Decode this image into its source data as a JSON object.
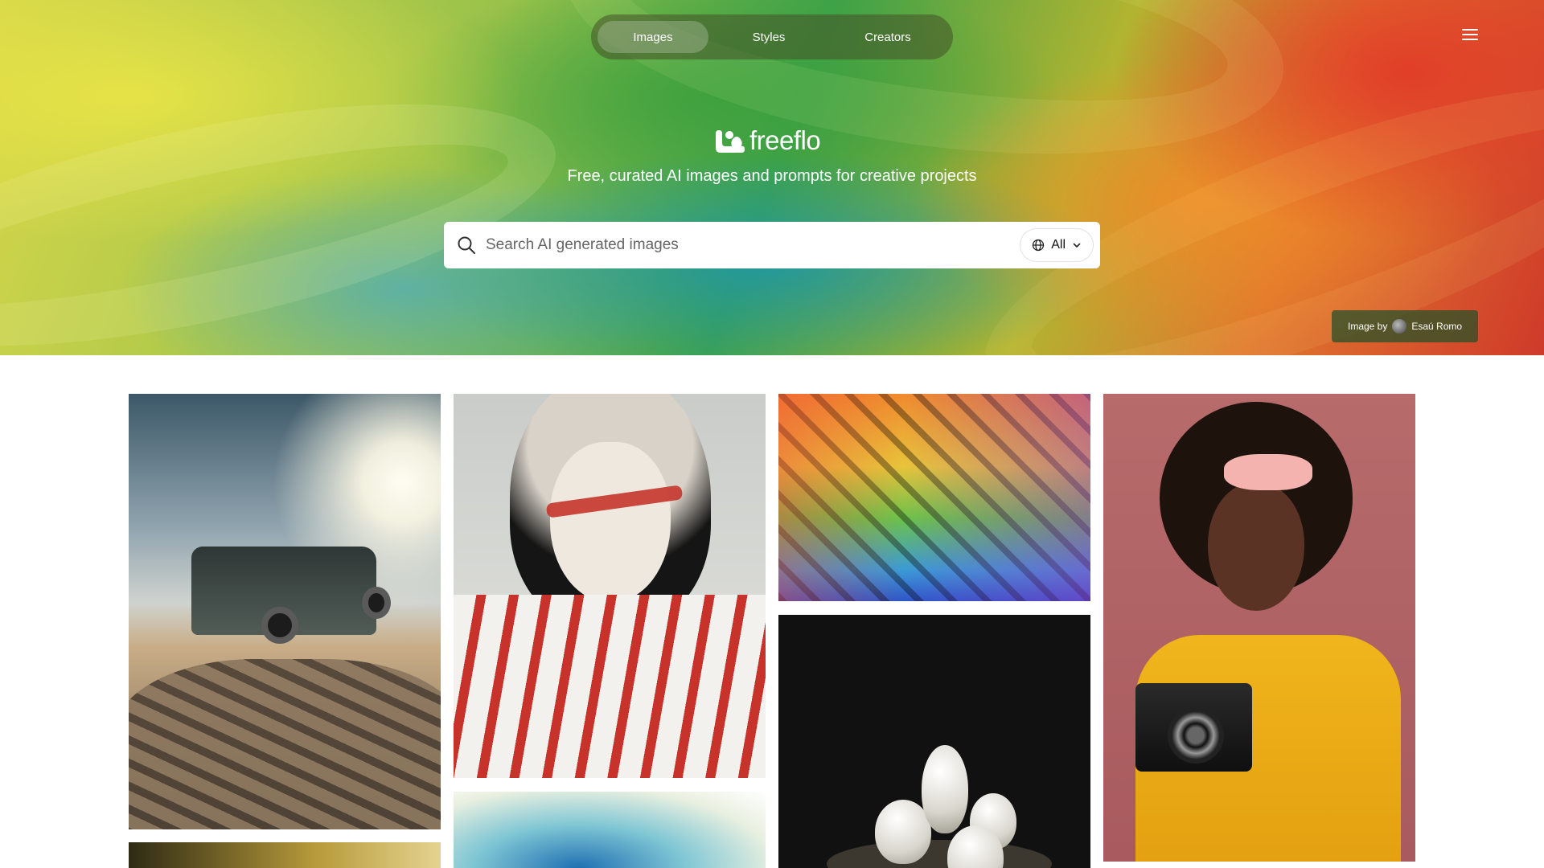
{
  "nav": {
    "tabs": [
      {
        "label": "Images",
        "active": true
      },
      {
        "label": "Styles",
        "active": false
      },
      {
        "label": "Creators",
        "active": false
      }
    ],
    "menu_icon": "hamburger-menu-icon"
  },
  "brand": {
    "name": "freeflo",
    "tagline": "Free, curated AI images and prompts for creative projects"
  },
  "search": {
    "placeholder": "Search AI generated images",
    "value": "",
    "filter_label": "All",
    "filter_icon": "globe-icon"
  },
  "hero_credit": {
    "prefix": "Image by",
    "author": "Esaú Romo"
  },
  "gallery": {
    "items": [
      {
        "subject": "car-in-desert"
      },
      {
        "subject": "face-paint-portrait"
      },
      {
        "subject": "rainbow-pattern"
      },
      {
        "subject": "white-eggs-nest"
      },
      {
        "subject": "woman-with-camera"
      },
      {
        "subject": "golden-bokeh"
      },
      {
        "subject": "watercolor"
      }
    ]
  },
  "colors": {
    "hero_pill_bg": "#465028",
    "credit_bg": "#285028",
    "text_on_hero": "#ffffff"
  }
}
